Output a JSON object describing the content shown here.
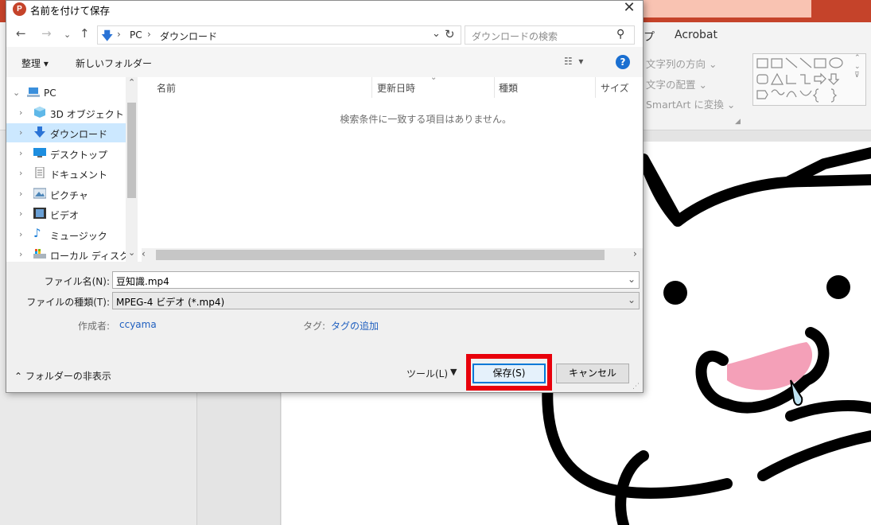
{
  "powerpoint": {
    "tabs": [
      "プ",
      "Acrobat"
    ],
    "commands": [
      "文字列の方向",
      "文字の配置",
      "SmartArt に変換"
    ]
  },
  "dialog": {
    "title": "名前を付けて保存",
    "app_icon_letter": "P",
    "address": [
      "PC",
      "ダウンロード"
    ],
    "search_placeholder": "ダウンロードの検索",
    "toolbar": {
      "organize": "整理",
      "new_folder": "新しいフォルダー"
    },
    "sidebar": [
      {
        "label": "PC",
        "icon": "pc-icon",
        "root": true
      },
      {
        "label": "3D オブジェクト",
        "icon": "3d-objects-icon"
      },
      {
        "label": "ダウンロード",
        "icon": "downloads-icon",
        "selected": true
      },
      {
        "label": "デスクトップ",
        "icon": "desktop-icon"
      },
      {
        "label": "ドキュメント",
        "icon": "documents-icon"
      },
      {
        "label": "ピクチャ",
        "icon": "pictures-icon"
      },
      {
        "label": "ビデオ",
        "icon": "videos-icon"
      },
      {
        "label": "ミュージック",
        "icon": "music-icon"
      },
      {
        "label": "ローカル ディスク (C",
        "icon": "local-disk-icon"
      }
    ],
    "columns": [
      "名前",
      "更新日時",
      "種類",
      "サイズ"
    ],
    "empty_message": "検索条件に一致する項目はありません。",
    "file_name_label": "ファイル名(N):",
    "file_name_value": "豆知識.mp4",
    "file_type_label": "ファイルの種類(T):",
    "file_type_value": "MPEG-4 ビデオ (*.mp4)",
    "author_label": "作成者:",
    "author_value": "ccyama",
    "tags_label": "タグ:",
    "tags_value": "タグの追加",
    "hide_folders": "フォルダーの非表示",
    "tools": "ツール(L)",
    "save": "保存(S)",
    "cancel": "キャンセル"
  },
  "colors": {
    "powerpoint_red": "#c5432a",
    "highlight_red": "#e8000b",
    "selection_blue": "#cce8ff",
    "link_blue": "#1f5fbf"
  }
}
